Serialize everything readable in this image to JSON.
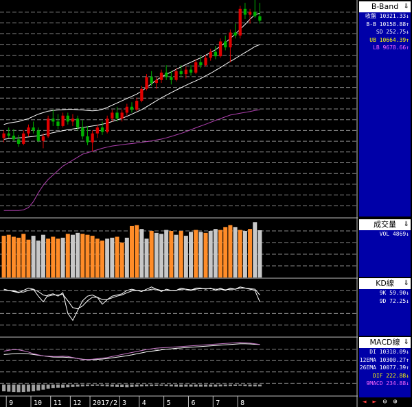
{
  "colors": {
    "up": "#e00000",
    "down": "#00b000",
    "bb_mid": "#ffffff",
    "bb_lower": "#b040b0",
    "bb_upper": "#ffffff",
    "vol_up": "#ff8c28",
    "vol_down": "#c8c8c8",
    "k": "#ffffff",
    "d": "#ffffff",
    "dif": "#c878c8",
    "macd_bar": "#a0a0a0"
  },
  "panels": [
    {
      "title": "B-Band",
      "rows": [
        {
          "label": "收盤",
          "value": "10321.33",
          "arrow": "↓",
          "color": "#ffffff"
        },
        {
          "label": "B-B",
          "value": "10158.88",
          "arrow": "↑",
          "color": "#ffffff"
        },
        {
          "label": "SD",
          "value": "252.75",
          "arrow": "↓",
          "color": "#ffffff"
        },
        {
          "label": "UB",
          "value": "10664.39",
          "arrow": "↑",
          "color": "#ffff00"
        },
        {
          "label": "LB",
          "value": "9678.66",
          "arrow": "↑",
          "color": "#ff66ff"
        }
      ]
    },
    {
      "title": "成交量",
      "rows": [
        {
          "label": "VOL",
          "value": "4869",
          "arrow": "↓",
          "color": "#ffffff"
        }
      ]
    },
    {
      "title": "KD線",
      "rows": [
        {
          "label": "9K",
          "value": "59.90",
          "arrow": "↓",
          "color": "#ffffff"
        },
        {
          "label": "9D",
          "value": "72.25",
          "arrow": "↓",
          "color": "#ffffff"
        }
      ]
    },
    {
      "title": "MACD線",
      "rows": [
        {
          "label": "DI",
          "value": "10310.09",
          "arrow": "↓",
          "color": "#ffffff"
        },
        {
          "label": "12EMA",
          "value": "10300.27",
          "arrow": "↑",
          "color": "#ffffff"
        },
        {
          "label": "26EMA",
          "value": "10077.39",
          "arrow": "↑",
          "color": "#ffffff"
        },
        {
          "label": "DIF",
          "value": "222.88",
          "arrow": "↓",
          "color": "#ffff00"
        },
        {
          "label": "9MACD",
          "value": "234.88",
          "arrow": "↓",
          "color": "#ff66ff"
        }
      ]
    }
  ],
  "toolbar": {
    "left": "◄",
    "right": "►",
    "zoom_out": "⊖",
    "zoom_in": "⊕"
  },
  "chart_data": {
    "type": "candlestick",
    "x_labels": [
      "9",
      "10",
      "11",
      "12",
      "2017/2",
      "3",
      "4",
      "5",
      "6",
      "7",
      "8"
    ],
    "candles": [
      [
        9530,
        9580,
        9500,
        9560
      ],
      [
        9560,
        9600,
        9530,
        9545
      ],
      [
        9545,
        9590,
        9510,
        9520
      ],
      [
        9520,
        9550,
        9470,
        9490
      ],
      [
        9490,
        9580,
        9480,
        9560
      ],
      [
        9560,
        9620,
        9540,
        9600
      ],
      [
        9600,
        9640,
        9560,
        9580
      ],
      [
        9580,
        9600,
        9500,
        9510
      ],
      [
        9510,
        9560,
        9460,
        9540
      ],
      [
        9540,
        9680,
        9530,
        9660
      ],
      [
        9660,
        9720,
        9610,
        9640
      ],
      [
        9640,
        9690,
        9590,
        9610
      ],
      [
        9610,
        9700,
        9600,
        9680
      ],
      [
        9680,
        9700,
        9620,
        9640
      ],
      [
        9640,
        9690,
        9610,
        9660
      ],
      [
        9660,
        9680,
        9580,
        9600
      ],
      [
        9600,
        9650,
        9520,
        9540
      ],
      [
        9540,
        9610,
        9480,
        9500
      ],
      [
        9500,
        9580,
        9440,
        9560
      ],
      [
        9560,
        9620,
        9530,
        9600
      ],
      [
        9600,
        9640,
        9550,
        9570
      ],
      [
        9570,
        9680,
        9560,
        9660
      ],
      [
        9660,
        9720,
        9640,
        9700
      ],
      [
        9700,
        9740,
        9640,
        9660
      ],
      [
        9660,
        9720,
        9640,
        9700
      ],
      [
        9700,
        9760,
        9680,
        9740
      ],
      [
        9740,
        9770,
        9700,
        9720
      ],
      [
        9720,
        9800,
        9710,
        9780
      ],
      [
        9780,
        9880,
        9770,
        9860
      ],
      [
        9860,
        9960,
        9850,
        9940
      ],
      [
        9940,
        9980,
        9880,
        9900
      ],
      [
        9900,
        9940,
        9860,
        9920
      ],
      [
        9920,
        9990,
        9900,
        9970
      ],
      [
        9970,
        10020,
        9920,
        9940
      ],
      [
        9940,
        9980,
        9890,
        9920
      ],
      [
        9920,
        10000,
        9910,
        9980
      ],
      [
        9980,
        10020,
        9940,
        9960
      ],
      [
        9960,
        10010,
        9930,
        9990
      ],
      [
        9990,
        10020,
        9950,
        9970
      ],
      [
        9970,
        10060,
        9960,
        10040
      ],
      [
        10040,
        10080,
        10000,
        10020
      ],
      [
        10020,
        10090,
        10010,
        10070
      ],
      [
        10070,
        10130,
        10050,
        10110
      ],
      [
        10110,
        10150,
        10060,
        10080
      ],
      [
        10080,
        10200,
        10070,
        10180
      ],
      [
        10180,
        10220,
        10120,
        10140
      ],
      [
        10140,
        10260,
        10040,
        10240
      ],
      [
        10240,
        10300,
        10200,
        10220
      ],
      [
        10220,
        10420,
        10200,
        10400
      ],
      [
        10400,
        10440,
        10330,
        10360
      ],
      [
        10360,
        10400,
        10300,
        10380
      ],
      [
        10380,
        10460,
        10340,
        10350
      ],
      [
        10350,
        10440,
        10300,
        10320
      ]
    ],
    "bb_mid": [
      9520,
      9525,
      9528,
      9530,
      9532,
      9536,
      9540,
      9545,
      9550,
      9558,
      9565,
      9572,
      9578,
      9585,
      9590,
      9595,
      9600,
      9605,
      9610,
      9615,
      9622,
      9630,
      9640,
      9650,
      9662,
      9675,
      9690,
      9705,
      9720,
      9740,
      9760,
      9780,
      9800,
      9818,
      9835,
      9852,
      9868,
      9885,
      9900,
      9915,
      9930,
      9948,
      9965,
      9985,
      10005,
      10025,
      10045,
      10065,
      10085,
      10105,
      10125,
      10145,
      10159
    ],
    "bb_upper": [
      9620,
      9630,
      9635,
      9640,
      9650,
      9660,
      9675,
      9690,
      9700,
      9710,
      9715,
      9718,
      9720,
      9722,
      9722,
      9720,
      9718,
      9715,
      9712,
      9715,
      9722,
      9735,
      9750,
      9765,
      9780,
      9795,
      9810,
      9825,
      9845,
      9870,
      9895,
      9920,
      9940,
      9958,
      9975,
      9992,
      10008,
      10025,
      10040,
      10055,
      10070,
      10088,
      10105,
      10125,
      10148,
      10172,
      10200,
      10230,
      10262,
      10295,
      10330,
      10360,
      10370
    ],
    "bb_lower": [
      9040,
      9040,
      9040,
      9040,
      9045,
      9060,
      9100,
      9160,
      9210,
      9250,
      9280,
      9310,
      9340,
      9360,
      9380,
      9400,
      9420,
      9430,
      9440,
      9450,
      9460,
      9468,
      9475,
      9480,
      9484,
      9488,
      9492,
      9496,
      9500,
      9505,
      9510,
      9516,
      9522,
      9530,
      9540,
      9550,
      9560,
      9572,
      9585,
      9598,
      9610,
      9622,
      9635,
      9648,
      9660,
      9672,
      9684,
      9690,
      9696,
      9702,
      9708,
      9715,
      9720
    ],
    "y_range": [
      9000,
      10450
    ],
    "volume": [
      [
        4300,
        "u"
      ],
      [
        4400,
        "u"
      ],
      [
        4200,
        "u"
      ],
      [
        4100,
        "u"
      ],
      [
        4500,
        "u"
      ],
      [
        3900,
        "u"
      ],
      [
        4300,
        "d"
      ],
      [
        3800,
        "d"
      ],
      [
        4400,
        "d"
      ],
      [
        4000,
        "u"
      ],
      [
        4200,
        "u"
      ],
      [
        4000,
        "u"
      ],
      [
        4100,
        "d"
      ],
      [
        4500,
        "u"
      ],
      [
        4400,
        "d"
      ],
      [
        4600,
        "d"
      ],
      [
        4500,
        "u"
      ],
      [
        4400,
        "u"
      ],
      [
        4300,
        "u"
      ],
      [
        4000,
        "u"
      ],
      [
        3800,
        "u"
      ],
      [
        4000,
        "d"
      ],
      [
        4100,
        "d"
      ],
      [
        4200,
        "u"
      ],
      [
        3600,
        "u"
      ],
      [
        4100,
        "d"
      ],
      [
        5300,
        "u"
      ],
      [
        5400,
        "u"
      ],
      [
        5000,
        "d"
      ],
      [
        4000,
        "d"
      ],
      [
        4800,
        "u"
      ],
      [
        4600,
        "d"
      ],
      [
        4500,
        "d"
      ],
      [
        4900,
        "d"
      ],
      [
        4800,
        "u"
      ],
      [
        4400,
        "d"
      ],
      [
        4800,
        "u"
      ],
      [
        4300,
        "d"
      ],
      [
        4700,
        "d"
      ],
      [
        4900,
        "u"
      ],
      [
        4700,
        "d"
      ],
      [
        4600,
        "u"
      ],
      [
        4800,
        "d"
      ],
      [
        5000,
        "d"
      ],
      [
        4900,
        "u"
      ],
      [
        5200,
        "u"
      ],
      [
        5400,
        "u"
      ],
      [
        5200,
        "d"
      ],
      [
        4900,
        "u"
      ],
      [
        4800,
        "d"
      ],
      [
        5000,
        "u"
      ],
      [
        5700,
        "d"
      ],
      [
        4869,
        "d"
      ]
    ],
    "vol_range": [
      0,
      6000
    ],
    "k": [
      82,
      80,
      78,
      76,
      80,
      84,
      82,
      70,
      60,
      72,
      74,
      70,
      76,
      40,
      28,
      45,
      62,
      70,
      72,
      68,
      56,
      64,
      70,
      72,
      74,
      80,
      82,
      80,
      78,
      82,
      86,
      82,
      78,
      82,
      80,
      80,
      84,
      82,
      80,
      84,
      84,
      82,
      84,
      80,
      84,
      80,
      84,
      82,
      86,
      84,
      82,
      80,
      60
    ],
    "d": [
      80,
      80,
      79,
      77,
      77,
      80,
      82,
      78,
      72,
      70,
      72,
      72,
      73,
      62,
      50,
      48,
      53,
      62,
      68,
      68,
      64,
      64,
      67,
      70,
      72,
      76,
      79,
      80,
      79,
      80,
      82,
      82,
      80,
      80,
      80,
      80,
      82,
      82,
      81,
      82,
      83,
      83,
      83,
      82,
      82,
      81,
      82,
      82,
      84,
      84,
      83,
      82,
      72
    ],
    "kd_range": [
      0,
      100
    ],
    "dif": [
      200,
      205,
      210,
      208,
      202,
      195,
      185,
      178,
      172,
      170,
      168,
      168,
      170,
      168,
      162,
      156,
      150,
      150,
      152,
      155,
      158,
      162,
      168,
      174,
      180,
      186,
      192,
      198,
      204,
      210,
      214,
      218,
      220,
      222,
      224,
      226,
      228,
      230,
      232,
      234,
      236,
      238,
      240,
      242,
      244,
      246,
      248,
      250,
      252,
      250,
      248,
      244,
      240
    ],
    "macd": [
      180,
      182,
      185,
      186,
      186,
      184,
      180,
      176,
      172,
      168,
      165,
      164,
      164,
      163,
      160,
      156,
      152,
      150,
      150,
      151,
      153,
      156,
      160,
      164,
      168,
      173,
      178,
      184,
      190,
      196,
      200,
      204,
      208,
      212,
      214,
      217,
      219,
      222,
      224,
      226,
      228,
      230,
      232,
      234,
      236,
      238,
      240,
      242,
      244,
      244,
      243,
      241,
      240
    ],
    "osc": [
      -40,
      -42,
      -44,
      -45,
      -44,
      -42,
      -40,
      -35,
      -30,
      -25,
      -20,
      -18,
      -18,
      -16,
      -14,
      -12,
      -10,
      -8,
      -7,
      -6,
      -8,
      -10,
      -12,
      -14,
      -15,
      -16,
      -14,
      -12,
      -10,
      -9,
      -8,
      -7,
      -6,
      -8,
      -10,
      -12,
      -13,
      -12,
      -12,
      -12,
      -12,
      -12,
      -12,
      -12,
      -10,
      -9,
      -8,
      -7,
      -6,
      -8,
      -10,
      -10,
      -10
    ],
    "macd_range": [
      -60,
      280
    ]
  }
}
